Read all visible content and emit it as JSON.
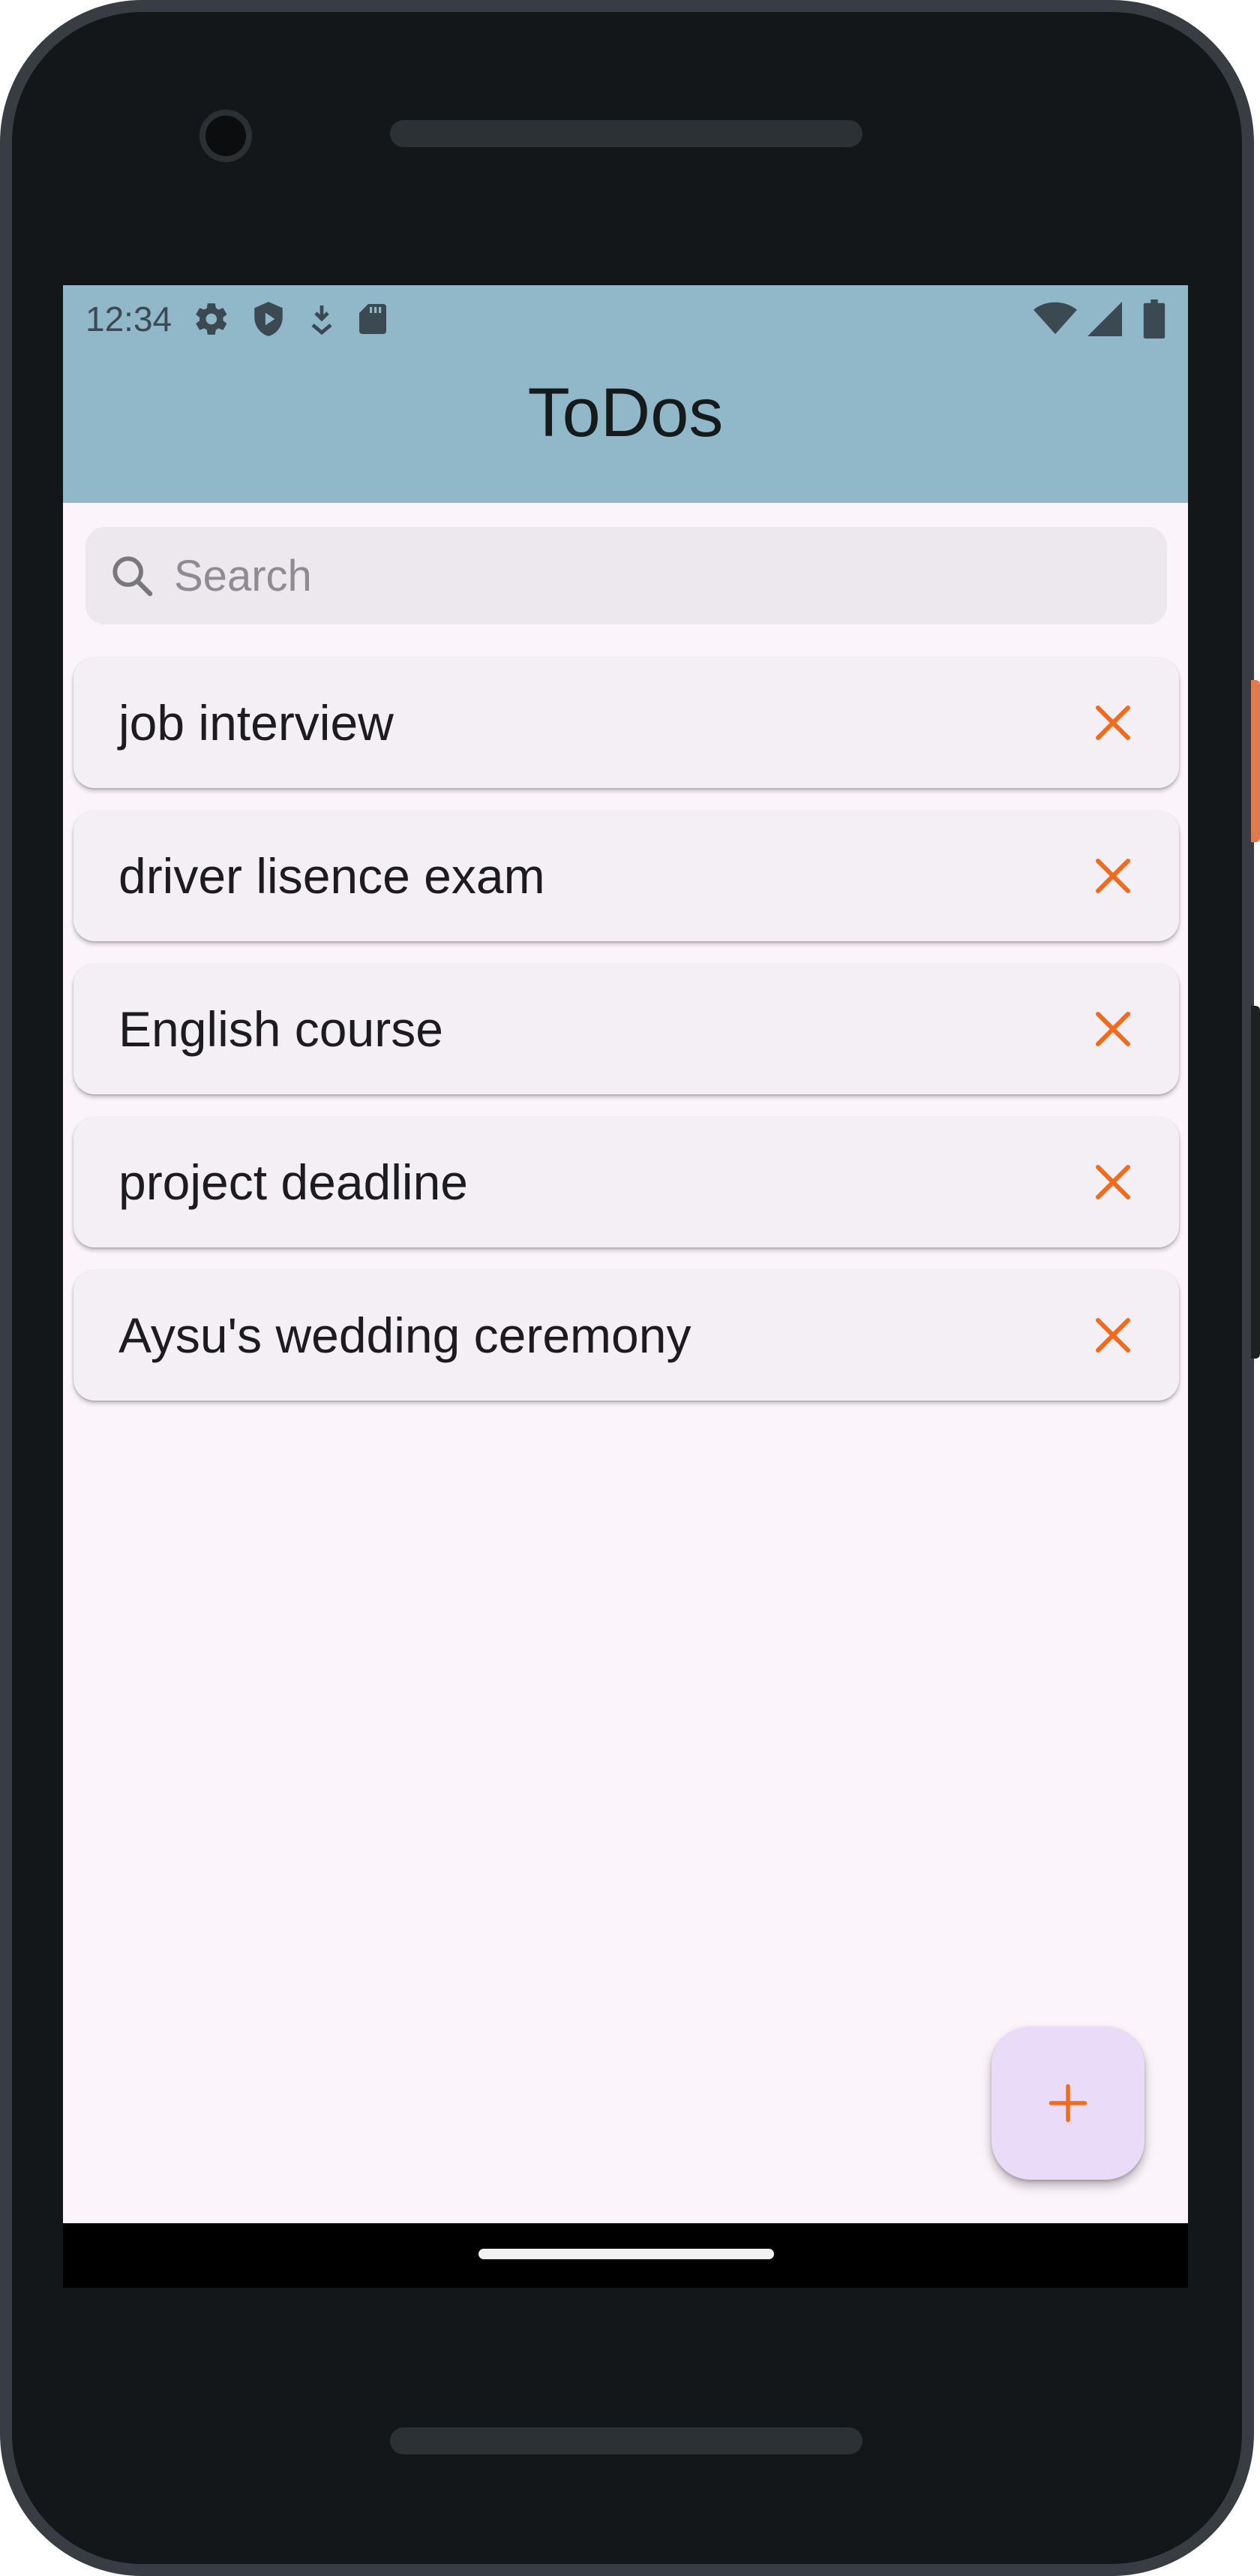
{
  "status_bar": {
    "time": "12:34",
    "left_icons": [
      "gear-icon",
      "shield-play-icon",
      "download-arrow-icon",
      "sd-card-icon"
    ],
    "right_icons": [
      "wifi-icon",
      "cellular-signal-icon",
      "battery-icon"
    ]
  },
  "app_bar": {
    "title": "ToDos"
  },
  "search": {
    "placeholder": "Search",
    "value": ""
  },
  "todos": [
    {
      "label": "job interview"
    },
    {
      "label": "driver lisence exam"
    },
    {
      "label": "English course"
    },
    {
      "label": "project deadline"
    },
    {
      "label": "Aysu's wedding ceremony"
    }
  ],
  "fab": {
    "icon": "plus-icon"
  },
  "colors": {
    "app_bar": "#90b8c9",
    "background": "#fcf4fb",
    "accent": "#ef6c1e",
    "card": "#f4eff5",
    "fab": "#eadcf8"
  }
}
